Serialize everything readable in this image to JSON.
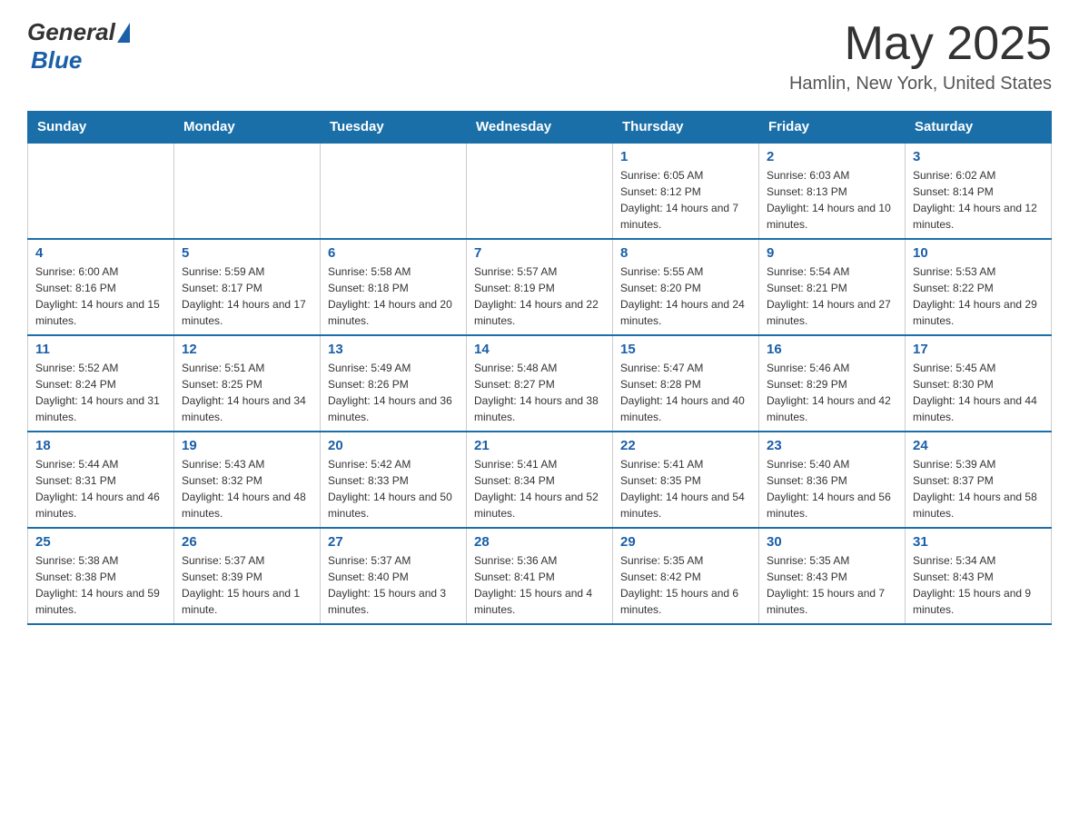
{
  "header": {
    "logo_general": "General",
    "logo_blue": "Blue",
    "month_year": "May 2025",
    "location": "Hamlin, New York, United States"
  },
  "days_of_week": [
    "Sunday",
    "Monday",
    "Tuesday",
    "Wednesday",
    "Thursday",
    "Friday",
    "Saturday"
  ],
  "weeks": [
    [
      {
        "day": "",
        "info": ""
      },
      {
        "day": "",
        "info": ""
      },
      {
        "day": "",
        "info": ""
      },
      {
        "day": "",
        "info": ""
      },
      {
        "day": "1",
        "info": "Sunrise: 6:05 AM\nSunset: 8:12 PM\nDaylight: 14 hours and 7 minutes."
      },
      {
        "day": "2",
        "info": "Sunrise: 6:03 AM\nSunset: 8:13 PM\nDaylight: 14 hours and 10 minutes."
      },
      {
        "day": "3",
        "info": "Sunrise: 6:02 AM\nSunset: 8:14 PM\nDaylight: 14 hours and 12 minutes."
      }
    ],
    [
      {
        "day": "4",
        "info": "Sunrise: 6:00 AM\nSunset: 8:16 PM\nDaylight: 14 hours and 15 minutes."
      },
      {
        "day": "5",
        "info": "Sunrise: 5:59 AM\nSunset: 8:17 PM\nDaylight: 14 hours and 17 minutes."
      },
      {
        "day": "6",
        "info": "Sunrise: 5:58 AM\nSunset: 8:18 PM\nDaylight: 14 hours and 20 minutes."
      },
      {
        "day": "7",
        "info": "Sunrise: 5:57 AM\nSunset: 8:19 PM\nDaylight: 14 hours and 22 minutes."
      },
      {
        "day": "8",
        "info": "Sunrise: 5:55 AM\nSunset: 8:20 PM\nDaylight: 14 hours and 24 minutes."
      },
      {
        "day": "9",
        "info": "Sunrise: 5:54 AM\nSunset: 8:21 PM\nDaylight: 14 hours and 27 minutes."
      },
      {
        "day": "10",
        "info": "Sunrise: 5:53 AM\nSunset: 8:22 PM\nDaylight: 14 hours and 29 minutes."
      }
    ],
    [
      {
        "day": "11",
        "info": "Sunrise: 5:52 AM\nSunset: 8:24 PM\nDaylight: 14 hours and 31 minutes."
      },
      {
        "day": "12",
        "info": "Sunrise: 5:51 AM\nSunset: 8:25 PM\nDaylight: 14 hours and 34 minutes."
      },
      {
        "day": "13",
        "info": "Sunrise: 5:49 AM\nSunset: 8:26 PM\nDaylight: 14 hours and 36 minutes."
      },
      {
        "day": "14",
        "info": "Sunrise: 5:48 AM\nSunset: 8:27 PM\nDaylight: 14 hours and 38 minutes."
      },
      {
        "day": "15",
        "info": "Sunrise: 5:47 AM\nSunset: 8:28 PM\nDaylight: 14 hours and 40 minutes."
      },
      {
        "day": "16",
        "info": "Sunrise: 5:46 AM\nSunset: 8:29 PM\nDaylight: 14 hours and 42 minutes."
      },
      {
        "day": "17",
        "info": "Sunrise: 5:45 AM\nSunset: 8:30 PM\nDaylight: 14 hours and 44 minutes."
      }
    ],
    [
      {
        "day": "18",
        "info": "Sunrise: 5:44 AM\nSunset: 8:31 PM\nDaylight: 14 hours and 46 minutes."
      },
      {
        "day": "19",
        "info": "Sunrise: 5:43 AM\nSunset: 8:32 PM\nDaylight: 14 hours and 48 minutes."
      },
      {
        "day": "20",
        "info": "Sunrise: 5:42 AM\nSunset: 8:33 PM\nDaylight: 14 hours and 50 minutes."
      },
      {
        "day": "21",
        "info": "Sunrise: 5:41 AM\nSunset: 8:34 PM\nDaylight: 14 hours and 52 minutes."
      },
      {
        "day": "22",
        "info": "Sunrise: 5:41 AM\nSunset: 8:35 PM\nDaylight: 14 hours and 54 minutes."
      },
      {
        "day": "23",
        "info": "Sunrise: 5:40 AM\nSunset: 8:36 PM\nDaylight: 14 hours and 56 minutes."
      },
      {
        "day": "24",
        "info": "Sunrise: 5:39 AM\nSunset: 8:37 PM\nDaylight: 14 hours and 58 minutes."
      }
    ],
    [
      {
        "day": "25",
        "info": "Sunrise: 5:38 AM\nSunset: 8:38 PM\nDaylight: 14 hours and 59 minutes."
      },
      {
        "day": "26",
        "info": "Sunrise: 5:37 AM\nSunset: 8:39 PM\nDaylight: 15 hours and 1 minute."
      },
      {
        "day": "27",
        "info": "Sunrise: 5:37 AM\nSunset: 8:40 PM\nDaylight: 15 hours and 3 minutes."
      },
      {
        "day": "28",
        "info": "Sunrise: 5:36 AM\nSunset: 8:41 PM\nDaylight: 15 hours and 4 minutes."
      },
      {
        "day": "29",
        "info": "Sunrise: 5:35 AM\nSunset: 8:42 PM\nDaylight: 15 hours and 6 minutes."
      },
      {
        "day": "30",
        "info": "Sunrise: 5:35 AM\nSunset: 8:43 PM\nDaylight: 15 hours and 7 minutes."
      },
      {
        "day": "31",
        "info": "Sunrise: 5:34 AM\nSunset: 8:43 PM\nDaylight: 15 hours and 9 minutes."
      }
    ]
  ]
}
